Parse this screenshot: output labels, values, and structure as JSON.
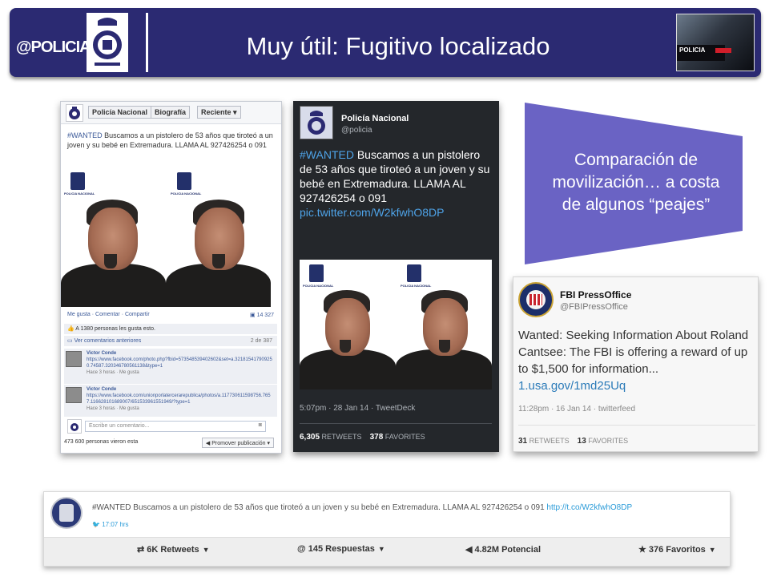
{
  "header": {
    "logo": "@POLICIA",
    "title": "Muy útil: Fugitivo localizado",
    "photo_vest_text": "POLICIA"
  },
  "facebook": {
    "page_button": "Policía Nacional",
    "bio_button": "Biografía",
    "recent_button": "Reciente",
    "post_hashtag": "#WANTED",
    "post_text": " Buscamos a un pistolero de 53 años que tiroteó a un joven y su bebé en Extremadura. LLAMA AL 927426254 o 091",
    "crest_label": "POLICIA NACIONAL",
    "actions": "Me gusta · Comentar · Compartir",
    "shares": "14 327",
    "likes": "A 1380 personas les gusta esto.",
    "prev_comments": "Ver comentarios anteriores",
    "comment_count": "2 de 387",
    "comments": [
      {
        "name": "Victor Conde",
        "text": "https://www.facebook.com/photo.php?fbid=573548539402602&set=a.321815417909250.74587.320346780561138&type=1",
        "meta": "Hace 3 horas · Me gusta"
      },
      {
        "name": "Victor Conde",
        "text": "https://www.facebook.com/unionporlatercerarepublica/photos/a.117730611598756.7657.116628101689007/651533961551949/?type=1",
        "meta": "Hace 3 horas · Me gusta"
      }
    ],
    "comment_placeholder": "Escribe un comentario...",
    "views": "473 600 personas vieron esta",
    "promote": "Promover publicación"
  },
  "twitter_dark": {
    "name": "Policía Nacional",
    "handle": "@policia",
    "hashtag": "#WANTED",
    "text": " Buscamos a un pistolero de 53 años que tiroteó a un joven y su bebé en Extremadura. LLAMA  AL 927426254 o 091 ",
    "link": "pic.twitter.com/W2kfwhO8DP",
    "meta": "5:07pm · 28 Jan 14 · TweetDeck",
    "retweets_value": "6,305",
    "retweets_label": "RETWEETS",
    "favorites_value": "378",
    "favorites_label": "FAVORITES"
  },
  "callout": {
    "text": "Comparación de movilización… a costa de algunos “peajes”",
    "color": "#6a63c4"
  },
  "fbi_tweet": {
    "name": "FBI PressOffice",
    "handle": "@FBIPressOffice",
    "text": "Wanted: Seeking Information About Roland Cantsee: The FBI is offering a reward of up to $1,500 for information... ",
    "link": "1.usa.gov/1md25Uq",
    "meta": "11:28pm · 16 Jan 14 · twitterfeed",
    "retweets_value": "31",
    "retweets_label": "RETWEETS",
    "favorites_value": "13",
    "favorites_label": "FAVORITES"
  },
  "bottom_tweet": {
    "hashtag": "#WANTED",
    "text": " Buscamos a un pistolero de 53 años que tiroteó a un joven y su bebé en Extremadura. LLAMA AL 927426254 o 091 ",
    "link": "http://t.co/W2kfwhO8DP",
    "time": "17:07 hrs",
    "retweets": "6K Retweets",
    "replies": "145 Respuestas",
    "potential": "4.82M Potencial",
    "favorites": "376 Favoritos"
  }
}
